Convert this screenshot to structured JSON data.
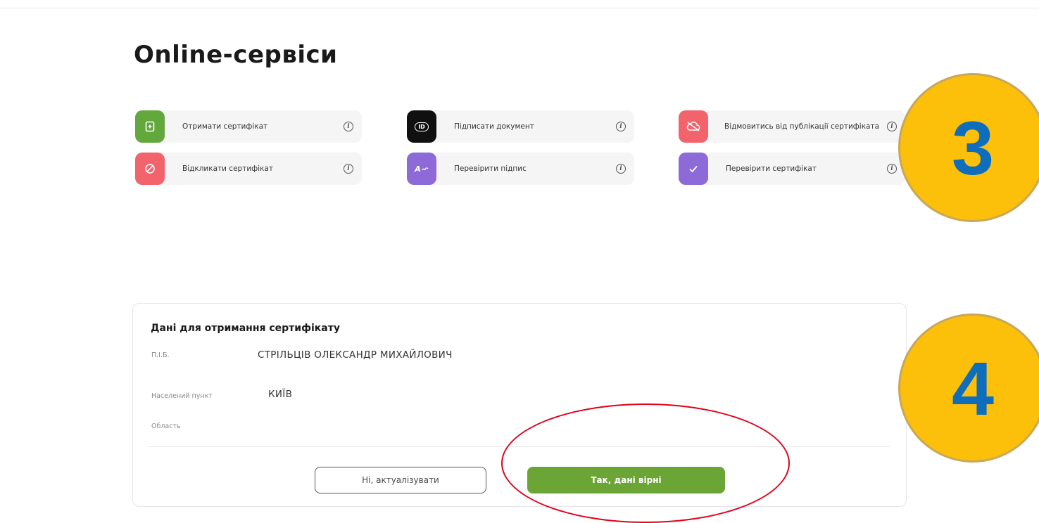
{
  "page": {
    "title": "Online-сервіси"
  },
  "services": [
    {
      "label": "Отримати сертифікат",
      "icon": "certificate-icon",
      "color": "#62a83d",
      "info_glyph": "i"
    },
    {
      "label": "Підписати документ",
      "icon": "id-icon",
      "color": "#101010",
      "info_glyph": "i"
    },
    {
      "label": "Відмовитись від публікації сертифіката",
      "icon": "cloud-off-icon",
      "color": "#f2636c",
      "info_glyph": "i"
    },
    {
      "label": "Відкликати сертифікат",
      "icon": "revoke-icon",
      "color": "#f2636c",
      "info_glyph": "i"
    },
    {
      "label": "Перевірити підпис",
      "icon": "signature-icon",
      "color": "#8e6ad8",
      "info_glyph": "i"
    },
    {
      "label": "Перевірити сертифікат",
      "icon": "check-icon",
      "color": "#8e6ad8",
      "info_glyph": "i"
    }
  ],
  "icon_glyphs": {
    "id": "ID",
    "signature": "A"
  },
  "certificate_form": {
    "title": "Дані для отримання сертифікату",
    "fields": [
      {
        "label": "П.І.Б.",
        "value": "СТРІЛЬЦІВ ОЛЕКСАНДР МИХАЙЛОВИЧ"
      },
      {
        "label": "Населений пункт",
        "value": "КИЇВ"
      },
      {
        "label": "Область",
        "value": ""
      }
    ],
    "actions": {
      "decline": "Ні, актуалізувати",
      "confirm": "Так, дані вірні"
    }
  },
  "annotations": {
    "steps": [
      "3",
      "4"
    ],
    "badge_color": "#fcbf0a",
    "number_color": "#0e6dbd",
    "highlight_color": "#e3001b"
  }
}
